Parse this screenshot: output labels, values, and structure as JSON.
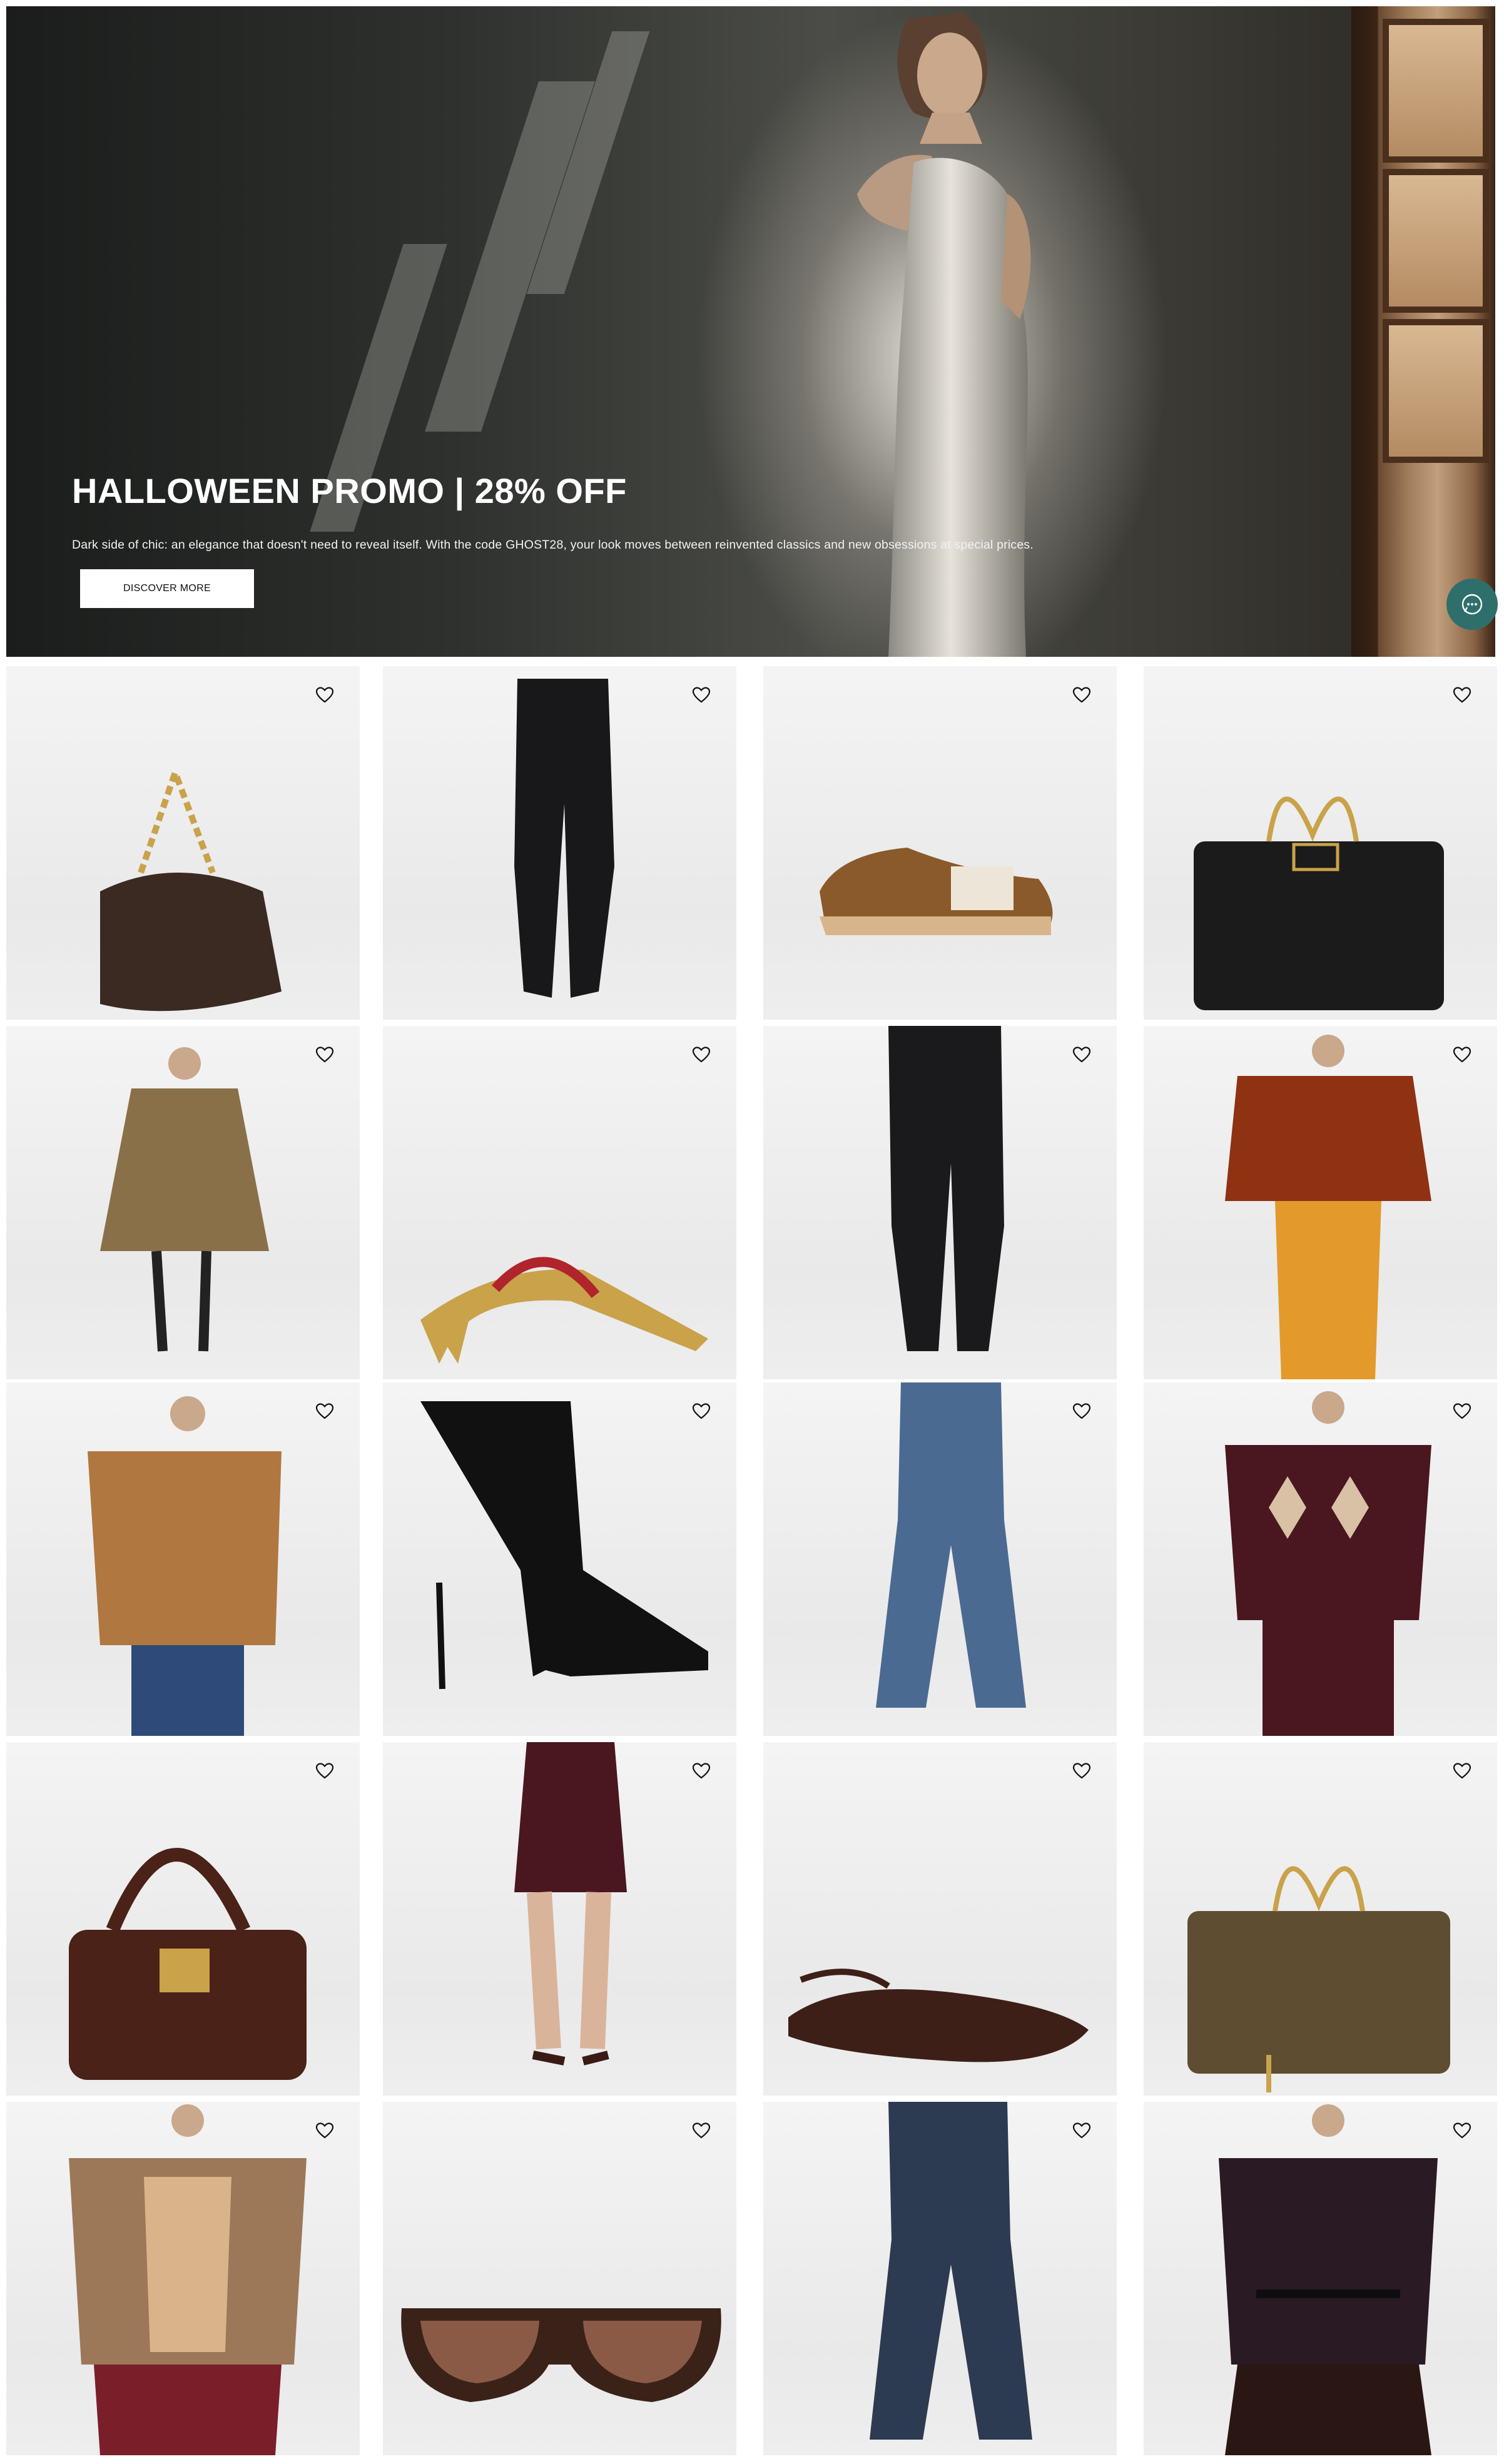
{
  "hero": {
    "title": "HALLOWEEN PROMO | 28% OFF",
    "description": "Dark side of chic: an elegance that doesn't need to reveal itself. With the code GHOST28, your look moves between reinvented classics and new obsessions at special prices.",
    "cta_label": "DISCOVER MORE"
  },
  "chat": {
    "icon": "chat-bubble-icon"
  },
  "colors": {
    "chat_bg": "#2f6f6b",
    "cta_bg": "#ffffff",
    "title": "#ffffff"
  },
  "products": [
    {
      "name": "product-brown-leather-clutch-chain",
      "icon": "heart-icon"
    },
    {
      "name": "product-black-leather-flared-trousers",
      "icon": "heart-icon"
    },
    {
      "name": "product-leopard-print-sneaker",
      "icon": "heart-icon"
    },
    {
      "name": "product-black-quilted-shoulder-bag",
      "icon": "heart-icon"
    },
    {
      "name": "product-leopard-print-cape",
      "icon": "heart-icon"
    },
    {
      "name": "product-gold-red-strappy-sandal",
      "icon": "heart-icon"
    },
    {
      "name": "product-black-leather-trousers",
      "icon": "heart-icon"
    },
    {
      "name": "product-rust-blouse-orange-skirt",
      "icon": "heart-icon"
    },
    {
      "name": "product-shearling-jacket",
      "icon": "heart-icon"
    },
    {
      "name": "product-black-leather-ankle-boot",
      "icon": "heart-icon"
    },
    {
      "name": "product-flared-blue-jeans",
      "icon": "heart-icon"
    },
    {
      "name": "product-argyle-sweater",
      "icon": "heart-icon"
    },
    {
      "name": "product-brown-padlock-bag",
      "icon": "heart-icon"
    },
    {
      "name": "product-argyle-mini-skirt",
      "icon": "heart-icon"
    },
    {
      "name": "product-brown-mary-jane-flat",
      "icon": "heart-icon"
    },
    {
      "name": "product-olive-quilted-shoulder-bag",
      "icon": "heart-icon"
    },
    {
      "name": "product-fur-jacket",
      "icon": "heart-icon"
    },
    {
      "name": "product-tortoise-shield-sunglasses",
      "icon": "heart-icon"
    },
    {
      "name": "product-dark-flared-jeans",
      "icon": "heart-icon"
    },
    {
      "name": "product-dark-purple-shirt",
      "icon": "heart-icon"
    }
  ]
}
